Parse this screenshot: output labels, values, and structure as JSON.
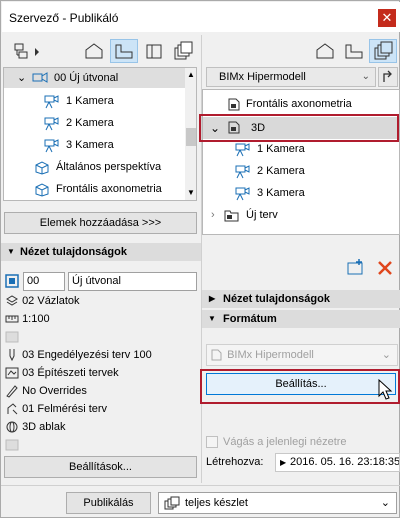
{
  "window": {
    "title": "Szervező - Publikáló"
  },
  "left_tree": {
    "items": [
      {
        "label": "00 Új útvonal"
      },
      {
        "label": "1 Kamera"
      },
      {
        "label": "2 Kamera"
      },
      {
        "label": "3 Kamera"
      },
      {
        "label": "Általános perspektíva"
      },
      {
        "label": "Frontális axonometria"
      }
    ]
  },
  "left": {
    "add_items_label": "Elemek hozzáadása >>>",
    "view_props_header": "Nézet tulajdonságok",
    "id_value": "00",
    "name_value": "Új útvonal",
    "props": [
      "02 Vázlatok",
      "1:100",
      "03 Engedélyezési terv 100",
      "03 Építészeti tervek",
      "No Overrides",
      "01 Felmérési terv",
      "3D ablak"
    ],
    "settings_label": "Beállítások..."
  },
  "right": {
    "set_dropdown": "BIMx Hipermodell",
    "tree": [
      {
        "label": "Frontális axonometria"
      },
      {
        "label": "3D"
      },
      {
        "label": "1 Kamera"
      },
      {
        "label": "2 Kamera"
      },
      {
        "label": "3 Kamera"
      },
      {
        "label": "Új terv"
      }
    ],
    "view_props_header": "Nézet tulajdonságok",
    "format_header": "Formátum",
    "format_value": "BIMx Hipermodell",
    "settings_label": "Beállítás...",
    "crop_label": "Vágás a jelenlegi nézetre",
    "created_label": "Létrehozva:",
    "created_value": "2016. 05. 16. 23:18:35"
  },
  "footer": {
    "publish_label": "Publikálás",
    "set_value": "teljes készlet"
  },
  "colors": {
    "selection": "#cce4f7",
    "highlight": "#b01c2e",
    "close": "#c42b1c"
  }
}
